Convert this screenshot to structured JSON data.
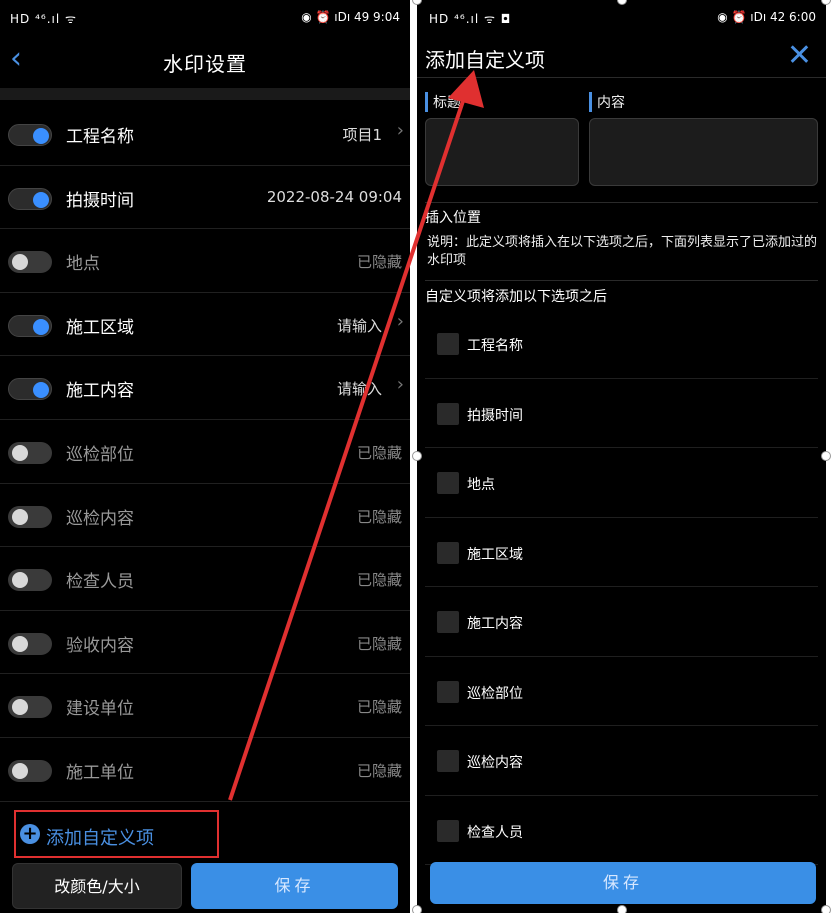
{
  "left": {
    "status": {
      "left": "HD ⁴⁶.ıl ᯤ",
      "right": "◉ ⏰ ıDı 49 9:04"
    },
    "title": "水印设置",
    "rows": [
      {
        "label": "工程名称",
        "value": "项目1",
        "on": true,
        "chevron": true
      },
      {
        "label": "拍摄时间",
        "value": "2022-08-24 09:04",
        "on": true,
        "chevron": false
      },
      {
        "label": "地点",
        "value": "已隐藏",
        "on": false,
        "chevron": false
      },
      {
        "label": "施工区域",
        "value": "请输入",
        "on": true,
        "chevron": true
      },
      {
        "label": "施工内容",
        "value": "请输入",
        "on": true,
        "chevron": true
      },
      {
        "label": "巡检部位",
        "value": "已隐藏",
        "on": false,
        "chevron": false
      },
      {
        "label": "巡检内容",
        "value": "已隐藏",
        "on": false,
        "chevron": false
      },
      {
        "label": "检查人员",
        "value": "已隐藏",
        "on": false,
        "chevron": false
      },
      {
        "label": "验收内容",
        "value": "已隐藏",
        "on": false,
        "chevron": false
      },
      {
        "label": "建设单位",
        "value": "已隐藏",
        "on": false,
        "chevron": false
      },
      {
        "label": "施工单位",
        "value": "已隐藏",
        "on": false,
        "chevron": false
      }
    ],
    "add_custom": "添加自定义项",
    "color_button": "改颜色/大小",
    "save_button": "保存"
  },
  "right": {
    "status": {
      "left": "HD ⁴⁶.ıl ᯤ ◘",
      "right": "◉ ⏰ ıDı 42 6:00"
    },
    "title": "添加自定义项",
    "title_label": "标题",
    "content_label": "内容",
    "insert_title": "插入位置",
    "insert_desc": "说明：此定义项将插入在以下选项之后，下面列表显示了已添加过的水印项",
    "after_title": "自定义项将添加以下选项之后",
    "options": [
      "工程名称",
      "拍摄时间",
      "地点",
      "施工区域",
      "施工内容",
      "巡检部位",
      "巡检内容",
      "检查人员"
    ],
    "save_button": "保存"
  },
  "colors": {
    "accent": "#4a90e2",
    "annotation": "#e03030",
    "background": "#000000"
  }
}
